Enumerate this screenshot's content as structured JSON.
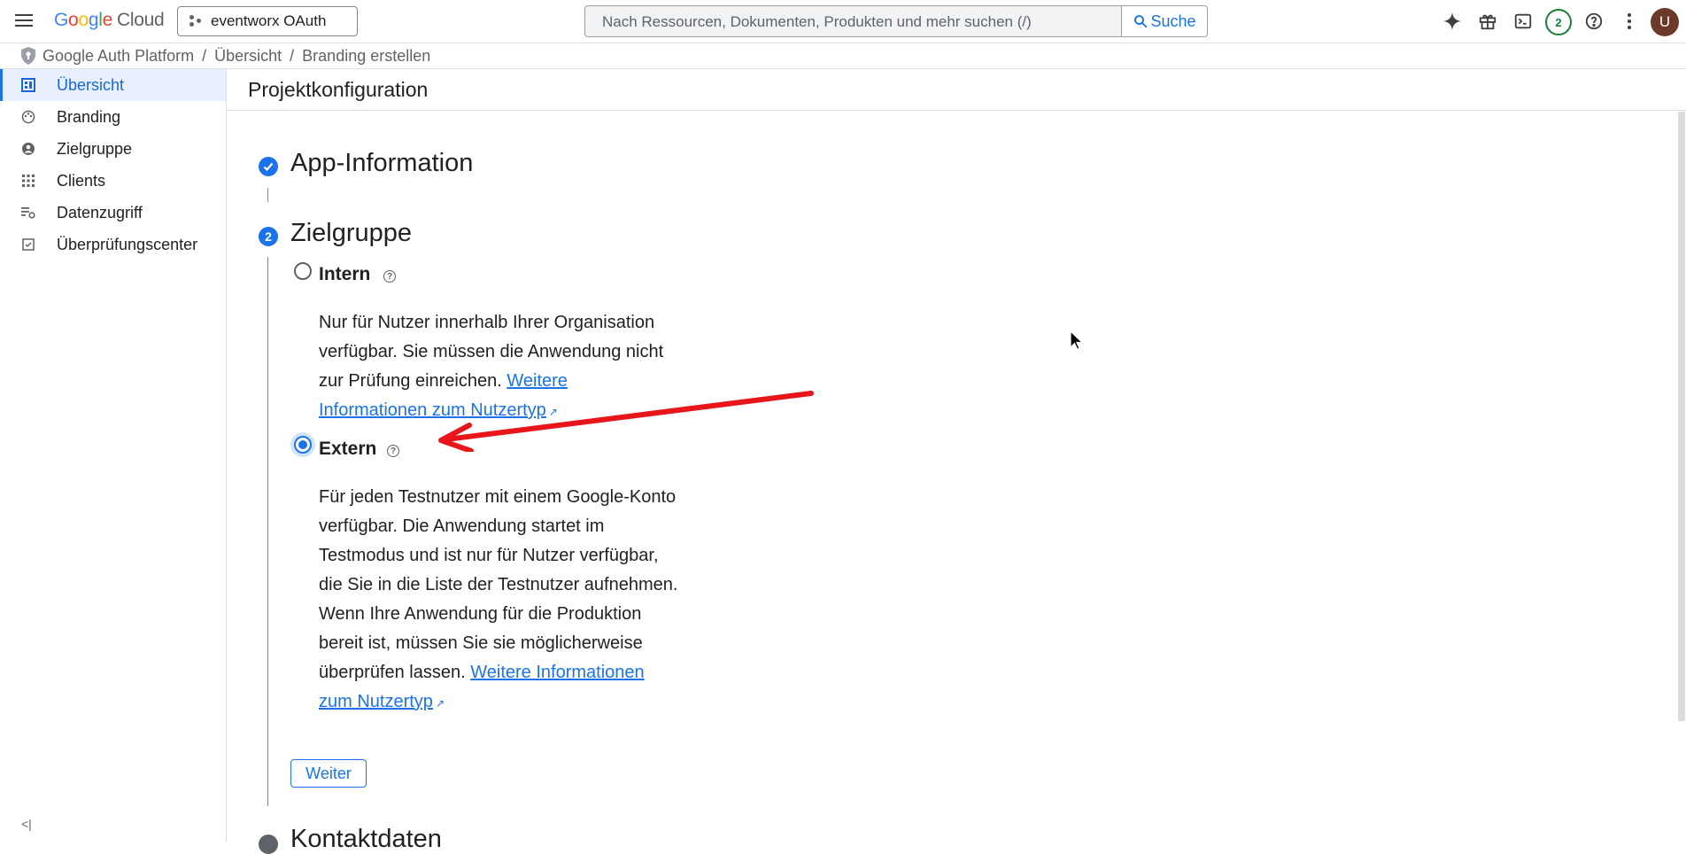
{
  "topbar": {
    "logo_google": "Google",
    "logo_cloud": "Cloud",
    "project_name": "eventworx OAuth",
    "search_placeholder": "Nach Ressourcen, Dokumenten, Produkten und mehr suchen (/)",
    "search_button": "Suche",
    "notification_count": "2",
    "avatar_initial": "U"
  },
  "breadcrumb": {
    "items": [
      "Google Auth Platform",
      "Übersicht",
      "Branding erstellen"
    ]
  },
  "sidebar": {
    "items": [
      {
        "label": "Übersicht",
        "icon": "dashboard-icon",
        "active": true
      },
      {
        "label": "Branding",
        "icon": "palette-icon"
      },
      {
        "label": "Zielgruppe",
        "icon": "person-icon"
      },
      {
        "label": "Clients",
        "icon": "apps-icon"
      },
      {
        "label": "Datenzugriff",
        "icon": "data-settings-icon"
      },
      {
        "label": "Überprüfungscenter",
        "icon": "verification-icon"
      }
    ],
    "collapse_label": "<|"
  },
  "main": {
    "page_title": "Projektkonfiguration",
    "steps": [
      {
        "title": "App-Information",
        "state": "done"
      },
      {
        "number": "2",
        "title": "Zielgruppe",
        "state": "current"
      },
      {
        "title": "Kontaktdaten",
        "state": "pending"
      }
    ],
    "options": {
      "intern": {
        "label": "Intern",
        "selected": false,
        "desc_lines": [
          "Nur für Nutzer innerhalb Ihrer Organisation",
          "verfügbar. Sie müssen die Anwendung nicht",
          "zur Prüfung einreichen."
        ],
        "link_part1": "Weitere",
        "link_part2": "Informationen zum Nutzertyp"
      },
      "extern": {
        "label": "Extern",
        "selected": true,
        "desc_lines": [
          "Für jeden Testnutzer mit einem Google-Konto",
          "verfügbar. Die Anwendung startet im",
          "Testmodus und ist nur für Nutzer verfügbar,",
          "die Sie in die Liste der Testnutzer aufnehmen.",
          "Wenn Ihre Anwendung für die Produktion",
          "bereit ist, müssen Sie sie möglicherweise",
          "überprüfen lassen."
        ],
        "link_part1": "Weitere Informationen",
        "link_part2": "zum Nutzertyp"
      }
    },
    "continue_button": "Weiter"
  },
  "annotation_color": "#e8161b",
  "accent_color": "#1a73e8"
}
